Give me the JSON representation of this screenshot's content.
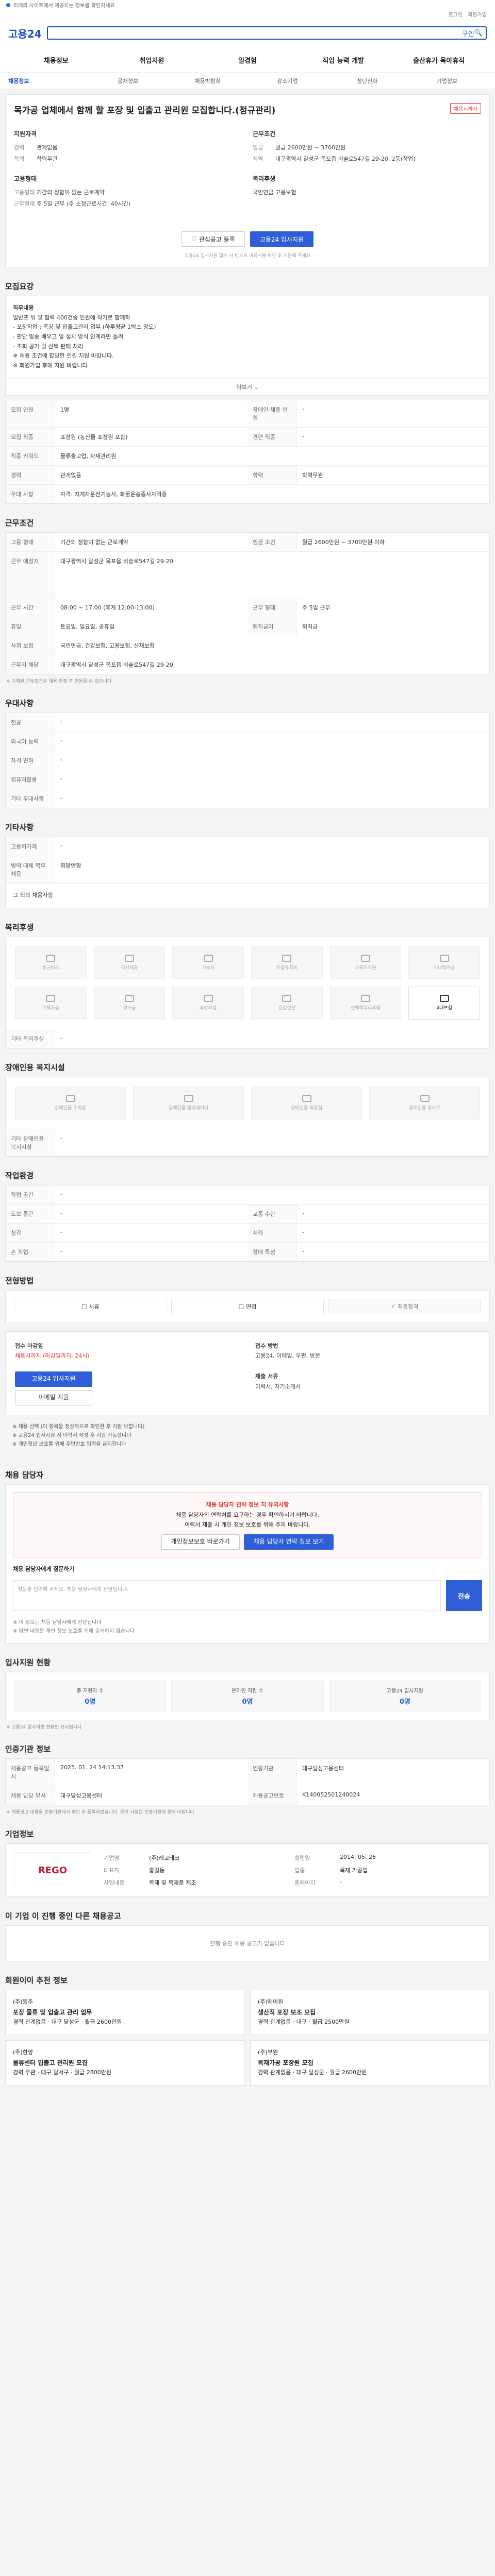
{
  "topbar": {
    "notice": "아래의 사이트에서 제공하는 정보를 확인하세요"
  },
  "header": {
    "logo": "고용24",
    "search_hint": "구인",
    "util": [
      "로그인",
      "회원가입"
    ],
    "nav": [
      "채용정보",
      "취업지원",
      "일경험",
      "직업 능력 개발",
      "출산휴가 육아휴직"
    ],
    "subnav": [
      "채용정보",
      "공채정보",
      "채용박람회",
      "강소기업",
      "청년친화",
      "기업정보"
    ]
  },
  "job": {
    "title": "목가공 업체에서 함께 할 포장 및 입출고 관리원 모집합니다.(정규관리)",
    "tag": "채용시까지",
    "left_head": "지원자격",
    "left": [
      {
        "k": "경력",
        "v": "관계없음"
      },
      {
        "k": "학력",
        "v": "학력무관"
      }
    ],
    "right_head": "근무조건",
    "right": [
      {
        "k": "임금",
        "v": "월급 2600만원 ~ 3700만원"
      },
      {
        "k": "지역",
        "v": "대구광역시 달성군 옥포읍 비슬로547길 29-20, 2동(창업)"
      }
    ],
    "left2_head": "고용형태",
    "left2": [
      {
        "k": "고용형태",
        "v": "기간의 정함이 없는 근로계약"
      },
      {
        "k": "근무형태",
        "v": "주 5일 근무 (주 소정근로시간: 40시간)"
      }
    ],
    "right2_head": "복리후생",
    "right2": [
      {
        "k": "",
        "v": "국민연금 고용보험"
      }
    ],
    "btn_fav": "관심공고 등록",
    "btn_apply": "고용24 입사지원",
    "note": "고용24 입사지원 접수 시 반드시 이력서를 확인 후 지원해 주세요"
  },
  "recruit": {
    "title": "모집요강",
    "desc_head": "직무내용",
    "desc": "일반포 뒤 및 협력 400건중 인원에 작가로 함께하\n- 포장작업 : 목공 및 입출고관리 업무 (하루평균 1박스 정도)\n- 판단 발송 배우고 일 설치 방식 인계라면 돌려\n- 조회 공가 및 선택 판매 처리\n※ 채용 조건에 합당한 인원 지원 바랍니다.\n※ 회원가입 후에 지원 바랍니다",
    "more": "더보기",
    "rows": [
      {
        "k": "모집 인원",
        "v": "1명",
        "k2": "장애인 채용 인원",
        "v2": "-"
      },
      {
        "k": "모집 직종",
        "v": "포장원 (농산물 포장원 포함)",
        "k2": "관련 직종",
        "v2": "-"
      },
      {
        "k": "직종 키워드",
        "v": "물류출고업, 자재관리원",
        "k2": "",
        "v2": ""
      },
      {
        "k": "경력",
        "v": "관계없음",
        "k2": "학력",
        "v2": "학력무관"
      },
      {
        "k": "우대 사항",
        "v": "자격: 지게차운전기능사, 화물운송종사자격증",
        "k2": "",
        "v2": ""
      }
    ]
  },
  "conditions": {
    "title": "근무조건",
    "rows": [
      {
        "k": "고용 형태",
        "v": "기간의 정함이 없는 근로계약",
        "k2": "임금 조건",
        "v2": "월급 2600만원 ~ 3700만원 이하"
      },
      {
        "k": "근무 예정지",
        "v": "대구광역시 달성군 옥포읍 비슬로547길 29-20",
        "k2": "",
        "v2": ""
      },
      {
        "k": "근무 시간",
        "v": "08:00 ~ 17:00 (휴게 12:00-13:00)",
        "k2": "근무 형태",
        "v2": "주 5일 근무"
      },
      {
        "k": "휴일",
        "v": "토요일, 일요일, 공휴일",
        "k2": "퇴직급여",
        "v2": "퇴직금"
      },
      {
        "k": "사회 보험",
        "v": "국민연금, 건강보험, 고용보험, 산재보험",
        "k2": "",
        "v2": ""
      },
      {
        "k": "근무지 해당",
        "v": "대구광역시 달성군 옥포읍 비슬로547길 29-20",
        "k2": "",
        "v2": ""
      }
    ],
    "foot": "※ 기재된 근무조건은 채용 확정 후 변동될 수 있습니다"
  },
  "prefer": {
    "title": "우대사항",
    "rows": [
      {
        "k": "전공",
        "v": "-"
      },
      {
        "k": "외국어 능력",
        "v": "-"
      },
      {
        "k": "자격 면허",
        "v": "-"
      },
      {
        "k": "컴퓨터활용",
        "v": "-"
      },
      {
        "k": "기타 우대사항",
        "v": "-"
      }
    ]
  },
  "extra": {
    "title": "기타사항",
    "rows": [
      {
        "k": "고용허가제",
        "v": "-"
      },
      {
        "k": "병역 대체 복무 채용",
        "v": "희망안함"
      }
    ],
    "note": "그 외의 채용사항"
  },
  "welfare": {
    "title": "복리후생",
    "items": [
      "통근버스",
      "식사제공",
      "기숙사",
      "차량유지비",
      "교육비지원",
      "자녀학자금",
      "주택자금",
      "경조금",
      "휴양시설",
      "건강검진",
      "선택적복리후생",
      "4대보험"
    ],
    "foot": "기타 복리후생"
  },
  "disabled": {
    "title": "장애인용 복지시설",
    "items": [
      "장애인용 주차장",
      "장애인용 엘리베이터",
      "장애인용 화장실",
      "장애인용 경사로"
    ],
    "foot": "기타 장애인용 복지시설"
  },
  "workenv": {
    "title": "작업환경",
    "rows": [
      {
        "k": "작업 공간",
        "v": "-",
        "k2": "",
        "v2": ""
      },
      {
        "k": "도보 통근",
        "v": "-",
        "k2": "교통 수단",
        "v2": "-"
      },
      {
        "k": "청각",
        "v": "-",
        "k2": "시력",
        "v2": "-"
      },
      {
        "k": "손 작업",
        "v": "-",
        "k2": "장애 특성",
        "v2": "-"
      }
    ]
  },
  "process": {
    "title": "전형방법",
    "steps": [
      "서류",
      "면접",
      "최종합격"
    ]
  },
  "apply": {
    "head1": "접수 마감일",
    "deadline": "채용시까지 (마감일까지: 24시)",
    "btn_apply": "고용24 입사지원",
    "btn_email": "이메일 지원",
    "head2": "접수 방법",
    "methods": [
      "고용24",
      "이메일",
      "우편",
      "방문"
    ],
    "head3": "제출 서류",
    "docs": "이력서, 자기소개서",
    "notes": "※ 채용 선택 (이 항목을 정상적으로 확인한 후 지원 바랍니다)\n※ 고용24 입사지원 시 이력서 작성 후 지원 가능합니다\n※ 개인정보 보호를 위해 주민번호 입력을 금지합니다"
  },
  "contact": {
    "title": "채용 담당자",
    "alert_head": "채용 담당자 연락 정보 지 유의사항",
    "alert": "채용 담당자의 연락처를 요구하는 경우 확인하시기 바랍니다.\n이력서 제출 시 개인 정보 보호를 위해 주의 바랍니다.",
    "alert_btn1": "개인정보보호 바로가기",
    "alert_btn2": "채용 담당자 연락 정보 보기",
    "question_head": "채용 담당자에게 질문하기",
    "question_hint": "질문을 입력해 주세요. 채용 담당자에게 전달됩니다.",
    "send": "전송",
    "notes": "※ 이 정보는 채용 담당자에게 전달됩니다\n※ 답변 내용은 개인 정보 보호를 위해 공개하지 않습니다"
  },
  "applicants": {
    "title": "입사지원 현황",
    "more": "더보기",
    "stats": [
      {
        "l": "총 지원자 수",
        "v": "0명"
      },
      {
        "l": "온라인 지원 수",
        "v": "0명"
      },
      {
        "l": "고용24 입사지원",
        "v": "0명"
      }
    ],
    "note": "※ 고용24 입사지원 현황만 표시됩니다"
  },
  "management": {
    "title": "인증기관 정보",
    "btn": "인증기관 정보 보기",
    "rows": [
      {
        "k": "채용공고 등록일시",
        "v": "2025. 01. 24 14:13:37",
        "k2": "인증기관",
        "v2": "대구달성고용센터"
      },
      {
        "k": "채용 담당 부서",
        "v": "대구달성고용센터",
        "k2": "채용공고번호",
        "v2": "K140052501240024"
      }
    ],
    "note": "※ 채용공고 내용을 인증기관에서 확인 후 등록하였습니다. 문의 사항은 인증기관에 문의 바랍니다"
  },
  "company": {
    "title": "기업정보",
    "logo": "REGO",
    "info": [
      {
        "k": "기업명",
        "v": "(주)레고테크"
      },
      {
        "k": "설립일",
        "v": "2014. 05. 26"
      },
      {
        "k": "대표자",
        "v": "홍길동"
      },
      {
        "k": "업종",
        "v": "목재 가공업"
      },
      {
        "k": "사업내용",
        "v": "목재 및 목재품 제조"
      },
      {
        "k": "홈페이지",
        "v": "-"
      }
    ]
  },
  "similar": {
    "title": "이 기업 이 진행 중인 다른 채용공고",
    "empty": "진행 중인 채용 공고가 없습니다"
  },
  "recommend": {
    "title": "회원이이 추천 정보",
    "items": [
      {
        "co": "(주)동주",
        "t": "포장 물류 및 입출고 관리 업무",
        "d": "경력 관계없음 · 대구 달성군 · 월급 2600만원"
      },
      {
        "co": "(주)에이원",
        "t": "생산직 포장 보조 모집",
        "d": "경력 관계없음 · 대구 · 월급 2500만원"
      },
      {
        "co": "(주)한양",
        "t": "물류센터 입출고 관리원 모집",
        "d": "경력 무관 · 대구 달서구 · 월급 2800만원"
      },
      {
        "co": "(주)부원",
        "t": "목재가공 포장원 모집",
        "d": "경력 관계없음 · 대구 달성군 · 월급 2600만원"
      }
    ]
  }
}
